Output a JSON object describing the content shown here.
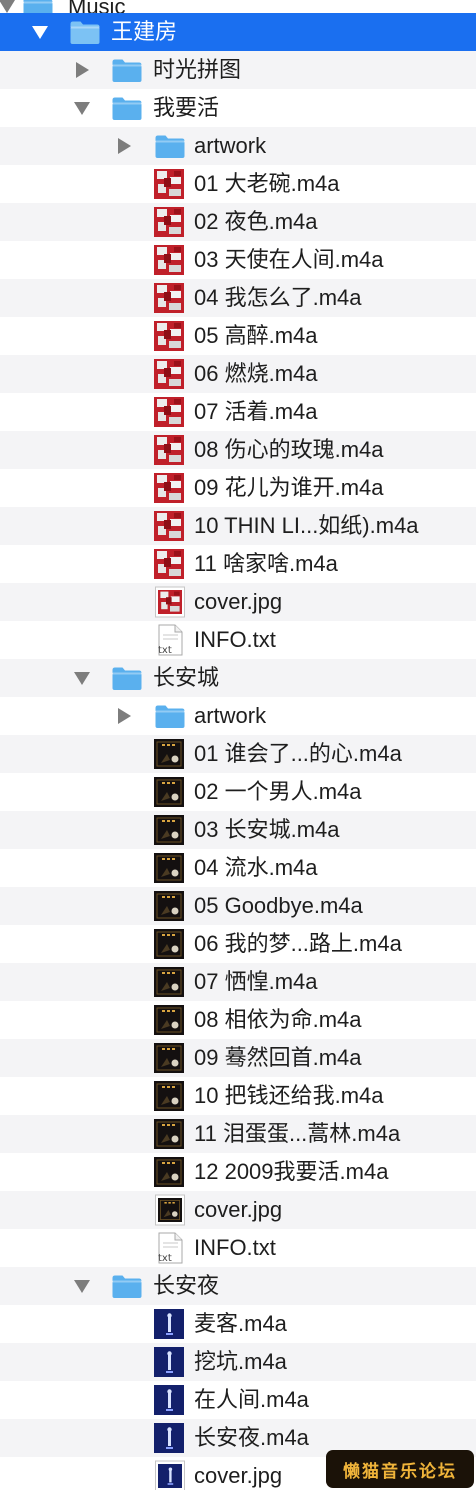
{
  "window": {
    "partial_top_label": "Music",
    "watermark_text": "懒猫音乐论坛"
  },
  "colors": {
    "selection": "#1a6ff0",
    "stripe": "#f4f4f6",
    "folder": "#5ab0ee",
    "disclosure": "#7d7d7d"
  },
  "tree": [
    {
      "label": "Music",
      "depth": 0,
      "kind": "folder",
      "disclosure": "open",
      "partial": true
    },
    {
      "label": "王建房",
      "depth": 1,
      "kind": "folder",
      "disclosure": "open",
      "selected": true
    },
    {
      "label": "时光拼图",
      "depth": 2,
      "kind": "folder",
      "disclosure": "closed"
    },
    {
      "label": "我要活",
      "depth": 2,
      "kind": "folder",
      "disclosure": "open"
    },
    {
      "label": "artwork",
      "depth": 3,
      "kind": "folder",
      "disclosure": "closed"
    },
    {
      "label": "01 大老碗.m4a",
      "depth": 3,
      "kind": "art-red"
    },
    {
      "label": "02 夜色.m4a",
      "depth": 3,
      "kind": "art-red"
    },
    {
      "label": "03 天使在人间.m4a",
      "depth": 3,
      "kind": "art-red"
    },
    {
      "label": "04 我怎么了.m4a",
      "depth": 3,
      "kind": "art-red"
    },
    {
      "label": "05 高醉.m4a",
      "depth": 3,
      "kind": "art-red"
    },
    {
      "label": "06 燃烧.m4a",
      "depth": 3,
      "kind": "art-red"
    },
    {
      "label": "07 活着.m4a",
      "depth": 3,
      "kind": "art-red"
    },
    {
      "label": "08 伤心的玫瑰.m4a",
      "depth": 3,
      "kind": "art-red"
    },
    {
      "label": "09 花儿为谁开.m4a",
      "depth": 3,
      "kind": "art-red"
    },
    {
      "label": "10 THIN LI...如纸).m4a",
      "depth": 3,
      "kind": "art-red"
    },
    {
      "label": "11 啥家啥.m4a",
      "depth": 3,
      "kind": "art-red"
    },
    {
      "label": "cover.jpg",
      "depth": 3,
      "kind": "art-red-doc"
    },
    {
      "label": "INFO.txt",
      "depth": 3,
      "kind": "txt"
    },
    {
      "label": "长安城",
      "depth": 2,
      "kind": "folder",
      "disclosure": "open"
    },
    {
      "label": "artwork",
      "depth": 3,
      "kind": "folder",
      "disclosure": "closed"
    },
    {
      "label": "01 谁会了...的心.m4a",
      "depth": 3,
      "kind": "art-dark"
    },
    {
      "label": "02 一个男人.m4a",
      "depth": 3,
      "kind": "art-dark"
    },
    {
      "label": "03 长安城.m4a",
      "depth": 3,
      "kind": "art-dark"
    },
    {
      "label": "04 流水.m4a",
      "depth": 3,
      "kind": "art-dark"
    },
    {
      "label": "05 Goodbye.m4a",
      "depth": 3,
      "kind": "art-dark"
    },
    {
      "label": "06 我的梦...路上.m4a",
      "depth": 3,
      "kind": "art-dark"
    },
    {
      "label": "07 恓惶.m4a",
      "depth": 3,
      "kind": "art-dark"
    },
    {
      "label": "08 相依为命.m4a",
      "depth": 3,
      "kind": "art-dark"
    },
    {
      "label": "09 蓦然回首.m4a",
      "depth": 3,
      "kind": "art-dark"
    },
    {
      "label": "10 把钱还给我.m4a",
      "depth": 3,
      "kind": "art-dark"
    },
    {
      "label": "11 泪蛋蛋...蒿林.m4a",
      "depth": 3,
      "kind": "art-dark"
    },
    {
      "label": "12 2009我要活.m4a",
      "depth": 3,
      "kind": "art-dark"
    },
    {
      "label": "cover.jpg",
      "depth": 3,
      "kind": "art-dark-doc"
    },
    {
      "label": "INFO.txt",
      "depth": 3,
      "kind": "txt"
    },
    {
      "label": "长安夜",
      "depth": 2,
      "kind": "folder",
      "disclosure": "open"
    },
    {
      "label": "麦客.m4a",
      "depth": 3,
      "kind": "art-blue"
    },
    {
      "label": "挖坑.m4a",
      "depth": 3,
      "kind": "art-blue"
    },
    {
      "label": "在人间.m4a",
      "depth": 3,
      "kind": "art-blue"
    },
    {
      "label": "长安夜.m4a",
      "depth": 3,
      "kind": "art-blue"
    },
    {
      "label": "cover.jpg",
      "depth": 3,
      "kind": "art-blue-doc"
    }
  ]
}
